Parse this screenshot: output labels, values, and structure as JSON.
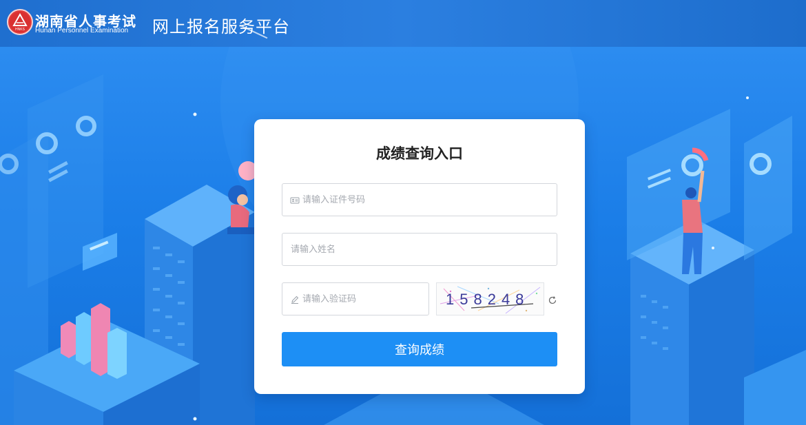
{
  "header": {
    "logo_cn": "湖南省人事考试",
    "logo_en": "Hunan Personnel Examination",
    "logo_badge_text": "HNKS",
    "platform_title": "网上报名服务平台"
  },
  "form": {
    "title": "成绩查询入口",
    "id_placeholder": "请输入证件号码",
    "name_placeholder": "请输入姓名",
    "captcha_placeholder": "请输入验证码",
    "captcha_text": "158248",
    "submit_label": "查询成绩"
  },
  "colors": {
    "primary": "#1d8ff5",
    "header": "#1f6fcf",
    "background": "#1b7fe6"
  },
  "icons": {
    "id_field": "id-card-icon",
    "captcha_field": "pencil-icon",
    "refresh": "refresh-icon"
  }
}
